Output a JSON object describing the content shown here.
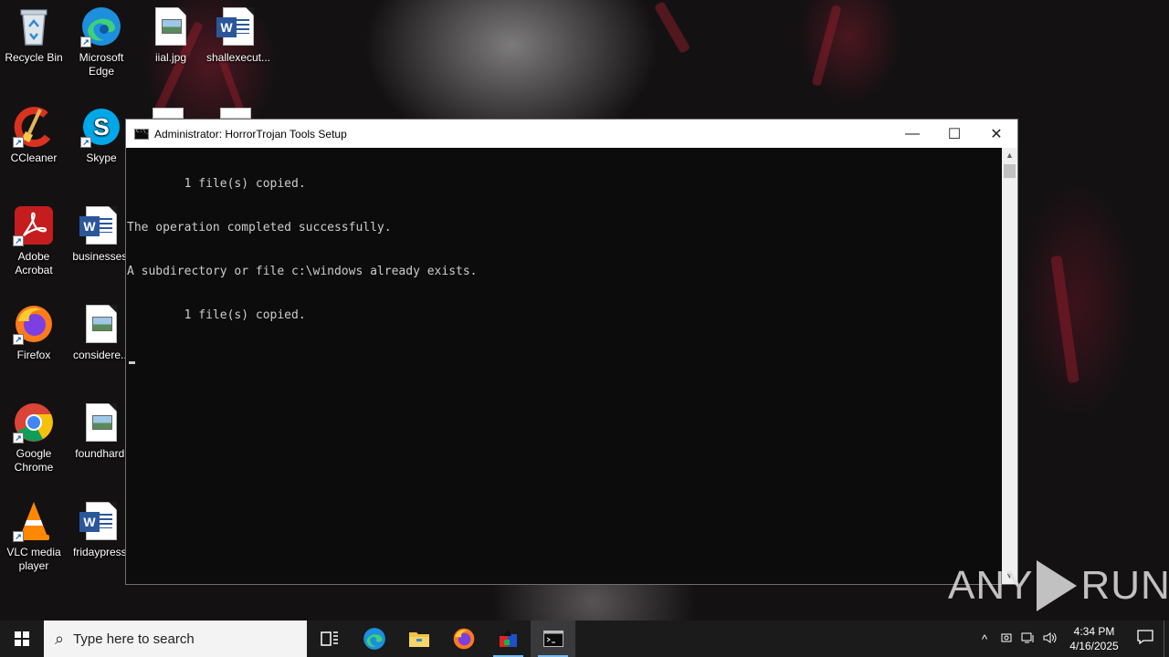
{
  "desktop": {
    "icons": [
      {
        "label": "Recycle Bin",
        "icon": "recycle-bin-icon"
      },
      {
        "label": "Microsoft Edge",
        "icon": "edge-icon"
      },
      {
        "label": "iial.jpg",
        "icon": "image-file-icon"
      },
      {
        "label": "shallexecut...",
        "icon": "word-doc-icon"
      },
      {
        "label": "CCleaner",
        "icon": "ccleaner-icon"
      },
      {
        "label": "Skype",
        "icon": "skype-icon"
      },
      {
        "label": "Adobe Acrobat",
        "icon": "acrobat-icon"
      },
      {
        "label": "businesses.",
        "icon": "word-doc-icon"
      },
      {
        "label": "Firefox",
        "icon": "firefox-icon"
      },
      {
        "label": "considere...",
        "icon": "image-file-icon"
      },
      {
        "label": "Google Chrome",
        "icon": "chrome-icon"
      },
      {
        "label": "foundhard.",
        "icon": "image-file-icon"
      },
      {
        "label": "VLC media player",
        "icon": "vlc-icon"
      },
      {
        "label": "fridaypress.",
        "icon": "word-doc-icon"
      }
    ]
  },
  "cmd_window": {
    "title": "Administrator:  HorrorTrojan Tools Setup",
    "lines": [
      "        1 file(s) copied.",
      "The operation completed successfully.",
      "A subdirectory or file c:\\windows already exists.",
      "        1 file(s) copied."
    ],
    "controls": {
      "minimize": "—",
      "maximize": "☐",
      "close": "✕"
    }
  },
  "watermark": {
    "left": "ANY",
    "right": "RUN"
  },
  "taskbar": {
    "search_placeholder": "Type here to search",
    "pinned": [
      "task-view-icon",
      "edge-icon",
      "file-explorer-icon",
      "firefox-icon",
      "installer-icon",
      "cmd-icon"
    ],
    "clock": {
      "time": "4:34 PM",
      "date": "4/16/2025"
    }
  },
  "colors": {
    "accent": "#76b9ed",
    "taskbar": "#1b1b1c",
    "console_bg": "#0c0c0c",
    "console_fg": "#cccccc"
  }
}
